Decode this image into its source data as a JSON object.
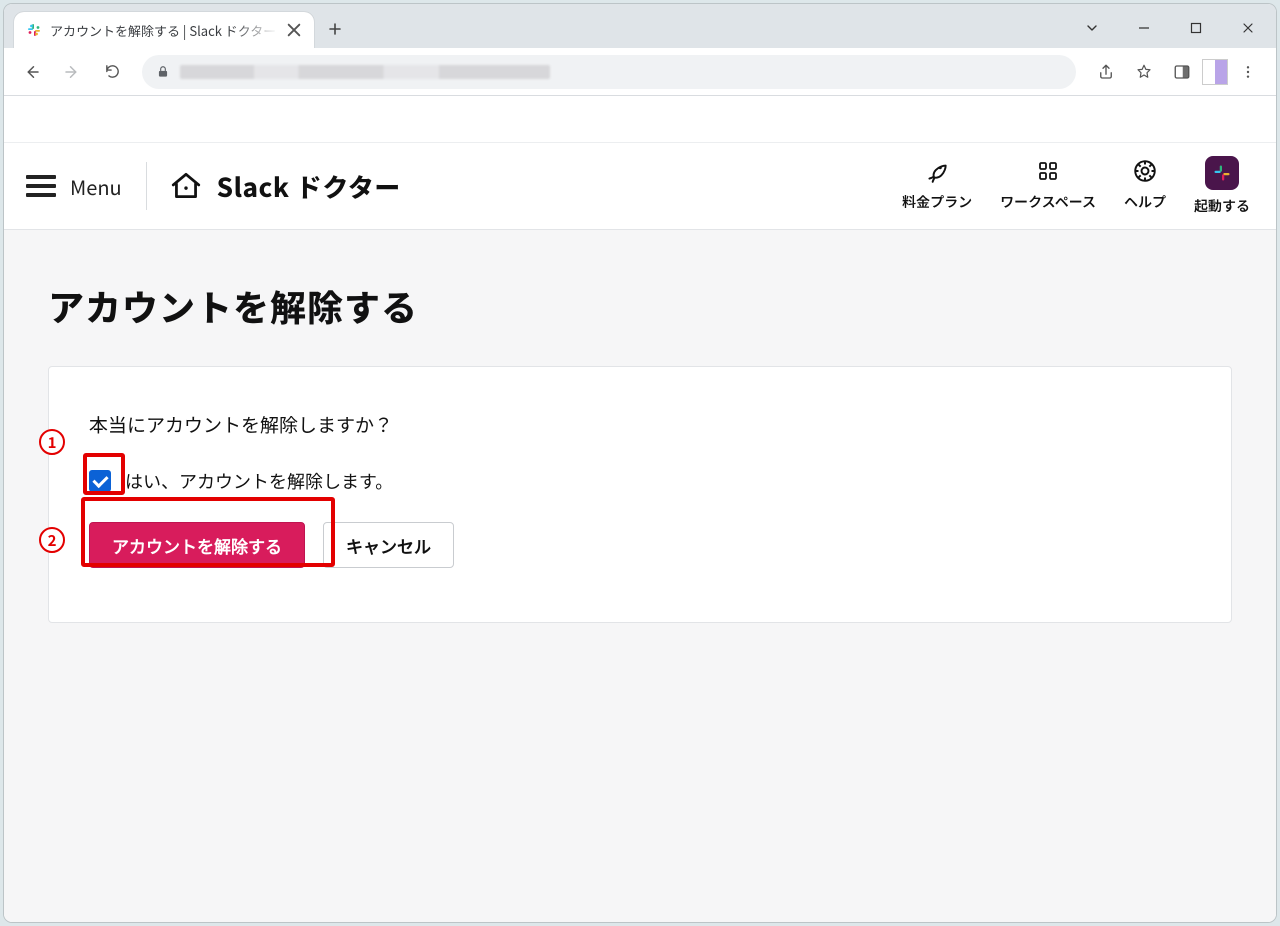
{
  "browser": {
    "tab_title": "アカウントを解除する | Slack ドクター",
    "new_tab_tooltip": "+"
  },
  "site_header": {
    "menu_label": "Menu",
    "brand": "Slack ドクター",
    "nav": [
      {
        "icon": "rocket-icon",
        "label": "料金プラン"
      },
      {
        "icon": "workspace-icon",
        "label": "ワークスペース"
      },
      {
        "icon": "help-icon",
        "label": "ヘルプ"
      },
      {
        "icon": "slack-icon",
        "label": "起動する"
      }
    ]
  },
  "page": {
    "title": "アカウントを解除する",
    "confirm_prompt": "本当にアカウントを解除しますか？",
    "checkbox_label": "はい、アカウントを解除します。",
    "checkbox_checked": true,
    "primary_button": "アカウントを解除する",
    "secondary_button": "キャンセル"
  },
  "annotations": {
    "step1": "1",
    "step2": "2"
  }
}
